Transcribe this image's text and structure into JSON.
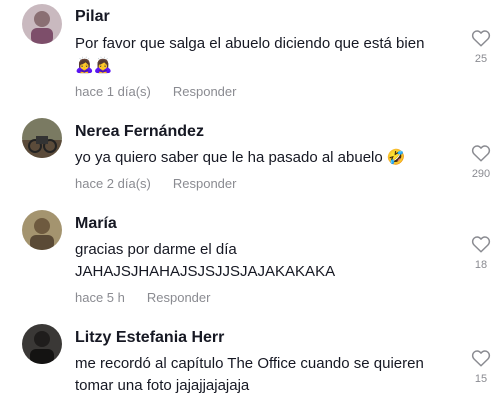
{
  "comments": [
    {
      "author": "Pilar",
      "lines": [
        "Por favor que salga el abuelo diciendo que está bien",
        "🙇‍♀️🙇‍♀️"
      ],
      "time": "hace 1 día(s)",
      "reply_label": "Responder",
      "likes": "25",
      "avatar_color": "#b7a0a7"
    },
    {
      "author": "Nerea Fernández",
      "lines": [
        "yo ya quiero saber que le ha pasado al abuelo 🤣"
      ],
      "time": "hace 2 día(s)",
      "reply_label": "Responder",
      "likes": "290",
      "avatar_color": "#6b6a55"
    },
    {
      "author": "María",
      "lines": [
        "gracias por darme el día",
        "JAHAJSJHAHAJSJSJJSJAJAKAKAKA"
      ],
      "time": "hace 5 h",
      "reply_label": "Responder",
      "likes": "18",
      "avatar_color": "#8b7a58"
    },
    {
      "author": "Litzy Estefania Herr",
      "lines": [
        "me recordó al capítulo The Office cuando se quieren",
        "tomar una foto jajajjajajaja"
      ],
      "time": "",
      "reply_label": "",
      "likes": "15",
      "avatar_color": "#2e2c2a"
    }
  ],
  "colors": {
    "text": "#161823",
    "muted": "#8a8b91",
    "background": "#ffffff"
  },
  "icons": {
    "like": "heart-outline-icon"
  }
}
